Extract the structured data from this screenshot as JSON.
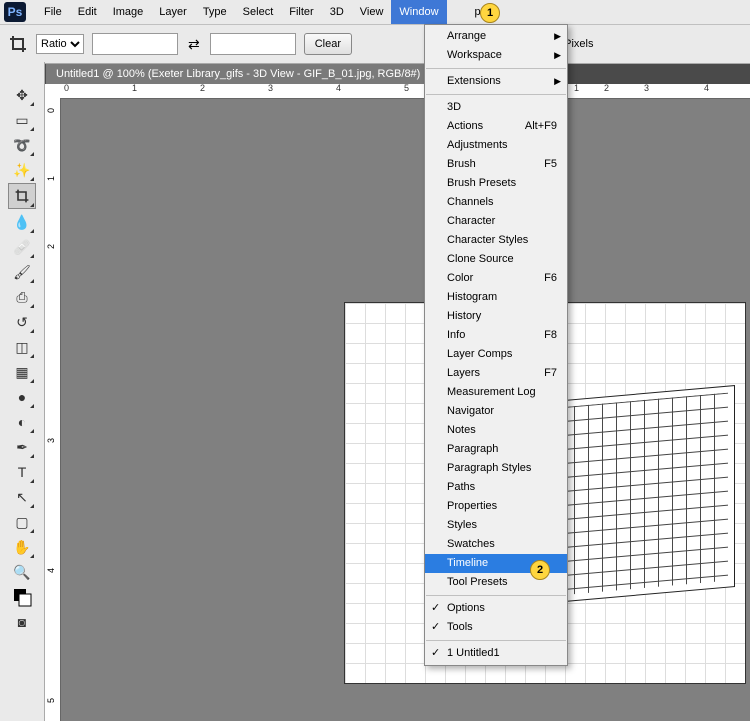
{
  "menubar": {
    "items": [
      "File",
      "Edit",
      "Image",
      "Layer",
      "Type",
      "Select",
      "Filter",
      "3D",
      "View",
      "Window",
      "Help"
    ],
    "active_index": 9
  },
  "badges": {
    "one": "1",
    "two": "2"
  },
  "optionsbar": {
    "ratio_label": "Ratio",
    "clear_label": "Clear",
    "delete_cropped_label": "Delete Cropped Pixels",
    "field1": "",
    "field2": ""
  },
  "tab": {
    "title": "Untitled1 @ 100% (Exeter Library_gifs - 3D View - GIF_B_01.jpg, RGB/8#)"
  },
  "ruler_h": {
    "marks": [
      "0",
      "1",
      "2",
      "3",
      "4",
      "5"
    ],
    "marks_right": [
      "1",
      "2",
      "3",
      "4"
    ]
  },
  "ruler_v": {
    "marks": [
      "0",
      "1",
      "2",
      "3",
      "4",
      "5"
    ]
  },
  "dropdown": {
    "groups": [
      [
        {
          "label": "Arrange",
          "submenu": true
        },
        {
          "label": "Workspace",
          "submenu": true
        }
      ],
      [
        {
          "label": "Extensions",
          "submenu": true
        }
      ],
      [
        {
          "label": "3D"
        },
        {
          "label": "Actions",
          "shortcut": "Alt+F9"
        },
        {
          "label": "Adjustments"
        },
        {
          "label": "Brush",
          "shortcut": "F5"
        },
        {
          "label": "Brush Presets"
        },
        {
          "label": "Channels"
        },
        {
          "label": "Character"
        },
        {
          "label": "Character Styles"
        },
        {
          "label": "Clone Source"
        },
        {
          "label": "Color",
          "shortcut": "F6"
        },
        {
          "label": "Histogram"
        },
        {
          "label": "History"
        },
        {
          "label": "Info",
          "shortcut": "F8"
        },
        {
          "label": "Layer Comps"
        },
        {
          "label": "Layers",
          "shortcut": "F7"
        },
        {
          "label": "Measurement Log"
        },
        {
          "label": "Navigator"
        },
        {
          "label": "Notes"
        },
        {
          "label": "Paragraph"
        },
        {
          "label": "Paragraph Styles"
        },
        {
          "label": "Paths"
        },
        {
          "label": "Properties"
        },
        {
          "label": "Styles"
        },
        {
          "label": "Swatches"
        },
        {
          "label": "Timeline",
          "highlight": true
        },
        {
          "label": "Tool Presets"
        }
      ],
      [
        {
          "label": "Options",
          "checked": true
        },
        {
          "label": "Tools",
          "checked": true
        }
      ],
      [
        {
          "label": "1 Untitled1",
          "checked": true
        }
      ]
    ]
  },
  "tools": [
    "move",
    "marquee",
    "lasso",
    "wand",
    "crop",
    "eyedropper",
    "heal",
    "brush",
    "stamp",
    "history-brush",
    "eraser",
    "gradient",
    "blur",
    "dodge",
    "pen",
    "type",
    "path-select",
    "shape",
    "hand",
    "zoom",
    "colors",
    "swap-colors"
  ]
}
